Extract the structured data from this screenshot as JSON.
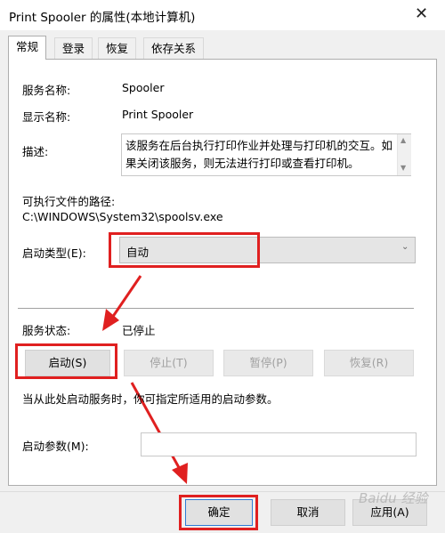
{
  "window": {
    "title": "Print Spooler 的属性(本地计算机)",
    "close_glyph": "✕"
  },
  "tabs": [
    {
      "label": "常规",
      "active": true
    },
    {
      "label": "登录",
      "active": false
    },
    {
      "label": "恢复",
      "active": false
    },
    {
      "label": "依存关系",
      "active": false
    }
  ],
  "general": {
    "service_name_label": "服务名称:",
    "service_name_value": "Spooler",
    "display_name_label": "显示名称:",
    "display_name_value": "Print Spooler",
    "description_label": "描述:",
    "description_text": "该服务在后台执行打印作业并处理与打印机的交互。如果关闭该服务，则无法进行打印或查看打印机。",
    "exe_path_label": "可执行文件的路径:",
    "exe_path_value": "C:\\WINDOWS\\System32\\spoolsv.exe",
    "startup_type_label": "启动类型(E):",
    "startup_type_value": "自动",
    "service_status_label": "服务状态:",
    "service_status_value": "已停止",
    "hint_text": "当从此处启动服务时，你可指定所适用的启动参数。",
    "start_params_label": "启动参数(M):",
    "start_params_value": ""
  },
  "service_buttons": {
    "start": "启动(S)",
    "stop": "停止(T)",
    "pause": "暂停(P)",
    "resume": "恢复(R)"
  },
  "footer": {
    "ok": "确定",
    "cancel": "取消",
    "apply": "应用(A)"
  },
  "watermark": "Baidu 经验",
  "colors": {
    "annotation_red": "#e02020",
    "focus_blue": "#2f7bd5"
  }
}
